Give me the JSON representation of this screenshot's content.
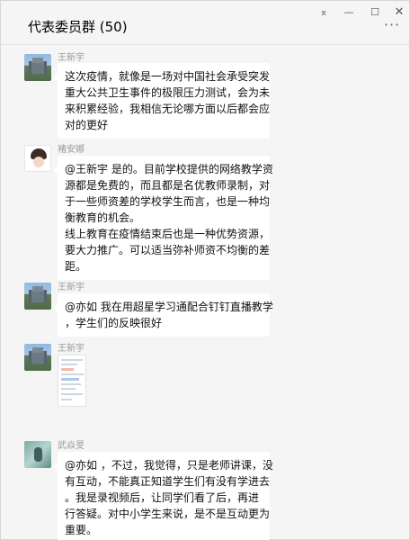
{
  "window": {
    "title": "代表委员群 (50)",
    "controls": {
      "pin": "⌅",
      "minimize": "—",
      "maximize": "☐",
      "close": "✕"
    },
    "more": "···"
  },
  "messages": [
    {
      "sender": "王新宇",
      "avatar": "building-photo",
      "lines": [
        "这次疫情，就像是一场对中国社会承受突发",
        "重大公共卫生事件的极限压力测试，会为未",
        "来积累经验，我相信无论哪方面以后都会应",
        "对的更好"
      ]
    },
    {
      "sender": "褚安娜",
      "avatar": "cartoon-girl",
      "lines": [
        "@王新宇 是的。目前学校提供的网络教学资",
        "源都是免费的，而且都是名优教师录制，对",
        "于一些师资差的学校学生而言，也是一种均",
        "衡教育的机会。",
        "线上教育在疫情结束后也是一种优势资源，",
        "要大力推广。可以适当弥补师资不均衡的差",
        "距。"
      ]
    },
    {
      "sender": "王新宇",
      "avatar": "building-photo",
      "lines": [
        "@亦如 我在用超星学习通配合钉钉直播教学",
        "，学生们的反映很好"
      ]
    },
    {
      "sender": "王新宇",
      "avatar": "building-photo",
      "image": "phone-screenshot-thumbnail"
    },
    {
      "sender": "武焱旻",
      "avatar": "teal-photo",
      "lines": [
        "@亦如 ，不过，我觉得，只是老师讲课，没",
        "有互动，不能真正知道学生们有没有学进去",
        "。我是录视频后，让同学们看了后，再进",
        "行答疑。对中小学生来说，是不是互动更为",
        "重要。"
      ]
    }
  ]
}
